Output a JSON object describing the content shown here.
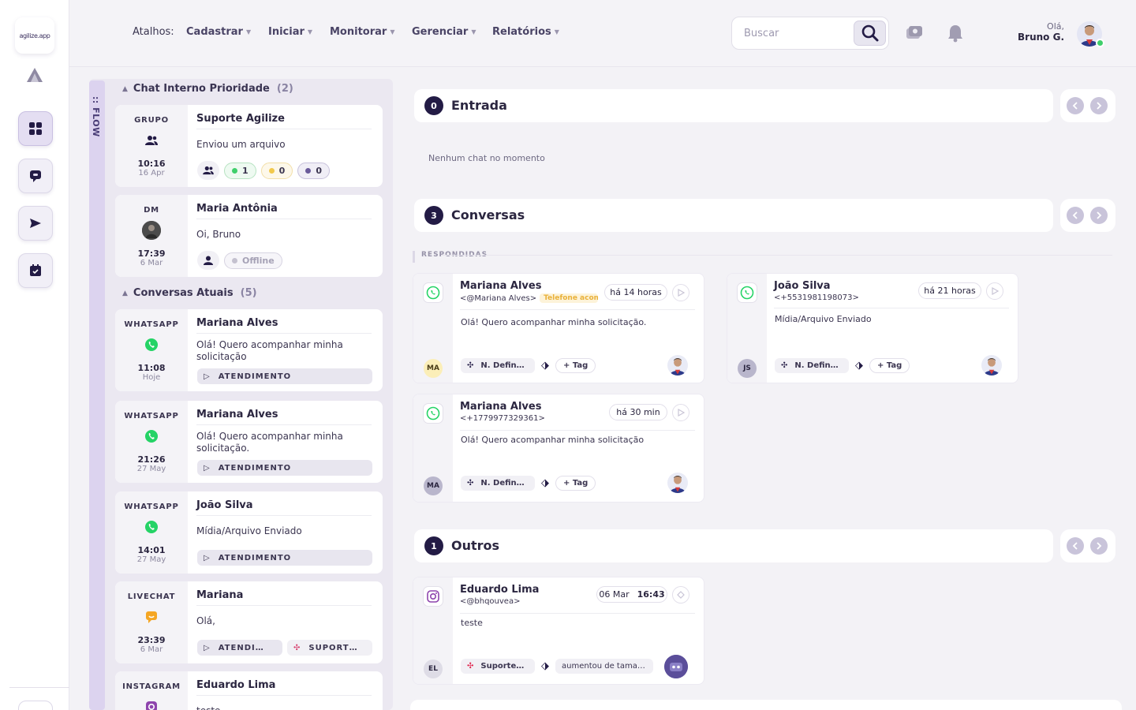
{
  "app": {
    "logo_text": "agilize.app"
  },
  "topbar": {
    "shortcuts_label": "Atalhos:",
    "menus": [
      "Cadastrar",
      "Iniciar",
      "Monitorar",
      "Gerenciar",
      "Relatórios"
    ],
    "search_placeholder": "Buscar",
    "greeting": "Olá,",
    "user_name": "Bruno G."
  },
  "flow_label": ":: FLOW",
  "left": {
    "priority_section": {
      "title": "Chat Interno Prioridade",
      "count": "(2)"
    },
    "priority_cards": [
      {
        "channel": "GRUPO",
        "name": "Suporte Agilize",
        "message": "Enviou um arquivo",
        "time": "10:16",
        "date": "16 Apr",
        "badges": [
          "1",
          "0",
          "0"
        ]
      },
      {
        "channel": "DM",
        "name": "Maria Antônia",
        "message": "Oi, Bruno",
        "time": "17:39",
        "date": "6 Mar",
        "status": "Offline"
      }
    ],
    "current_section": {
      "title": "Conversas Atuais",
      "count": "(5)"
    },
    "current_cards": [
      {
        "channel": "WHATSAPP",
        "name": "Mariana Alves",
        "message": "Olá! Quero acompanhar minha solicitação",
        "time": "11:08",
        "date": "Hoje",
        "pill": "ATENDIMENTO"
      },
      {
        "channel": "WHATSAPP",
        "name": "Mariana Alves",
        "message": "Olá! Quero acompanhar minha solicitação.",
        "time": "21:26",
        "date": "27 May",
        "pill": "ATENDIMENTO"
      },
      {
        "channel": "WHATSAPP",
        "name": "João Silva",
        "message": "Mídia/Arquivo Enviado",
        "time": "14:01",
        "date": "27 May",
        "pill": "ATENDIMENTO"
      },
      {
        "channel": "LIVECHAT",
        "name": "Mariana",
        "message": "Olá,",
        "time": "23:39",
        "date": "6 Mar",
        "pill": "ATENDIMENTO",
        "pill2": "SUPORTE AGILIZE"
      },
      {
        "channel": "INSTAGRAM",
        "name": "Eduardo Lima",
        "message": "teste",
        "time": "",
        "date": ""
      }
    ]
  },
  "sections": {
    "entrada": {
      "count": "0",
      "title": "Entrada",
      "empty": "Nenhum chat no momento"
    },
    "conversas": {
      "count": "3",
      "title": "Conversas",
      "subsection": "RESPONDIDAS"
    },
    "outros": {
      "count": "1",
      "title": "Outros"
    }
  },
  "conversas_cards": [
    {
      "name": "Mariana Alves",
      "handle": "<@Mariana Alves>",
      "tag": "Telefone acompanhamento",
      "time": "há 14 horas",
      "message": "Olá! Quero acompanhar minha solicitação.",
      "initials": "MA",
      "dept": "N. Definido",
      "add_tag": "+ Tag"
    },
    {
      "name": "João Silva",
      "handle": "<+5531981198073>",
      "time": "há 21 horas",
      "message": "Mídia/Arquivo Enviado",
      "initials": "JS",
      "dept": "N. Definido",
      "add_tag": "+ Tag"
    },
    {
      "name": "Mariana Alves",
      "handle": "<+1779977329361>",
      "time": "há 30 min",
      "message": "Olá! Quero acompanhar minha solicitação",
      "initials": "MA",
      "dept": "N. Definido",
      "add_tag": "+ Tag"
    }
  ],
  "outros_cards": [
    {
      "name": "Eduardo Lima",
      "handle": "<@bhqouvea>",
      "date": "06 Mar",
      "time": "16:43",
      "message": "teste",
      "initials": "EL",
      "dept": "Suporte Agilize",
      "tag": "aumentou de tamanho"
    }
  ],
  "colors": {
    "primary": "#231b45",
    "whatsapp": "#25d366",
    "instagram": "#8e44ad",
    "livechat": "#f5a623",
    "accent_soft": "#dcd3ef"
  }
}
